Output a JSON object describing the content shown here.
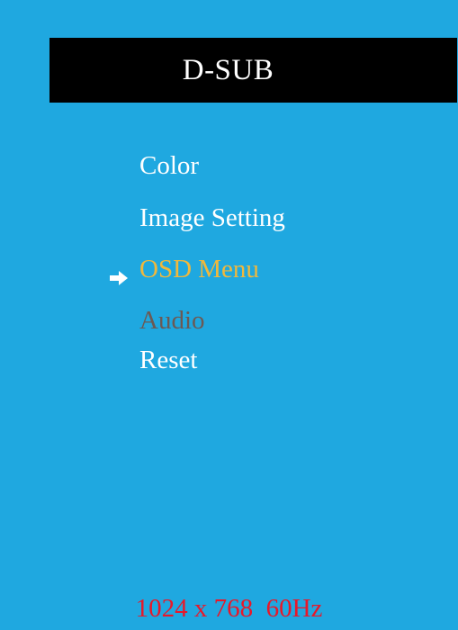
{
  "header": {
    "input_source": "D-SUB"
  },
  "menu": {
    "items": [
      {
        "label": "Color",
        "state": "normal"
      },
      {
        "label": "Image Setting",
        "state": "normal"
      },
      {
        "label": "OSD Menu",
        "state": "selected"
      },
      {
        "label": "Audio",
        "state": "disabled"
      },
      {
        "label": "Reset",
        "state": "normal"
      }
    ],
    "selected_index": 2,
    "pointer_icon": "right-arrow-icon"
  },
  "status": {
    "resolution_text": "1024 x 768  60Hz"
  },
  "colors": {
    "background": "#1fa8e0",
    "banner": "#000000",
    "text_normal": "#ffffff",
    "text_selected": "#f0b83c",
    "text_disabled": "#6b5a55",
    "status_text": "#e8182a"
  }
}
